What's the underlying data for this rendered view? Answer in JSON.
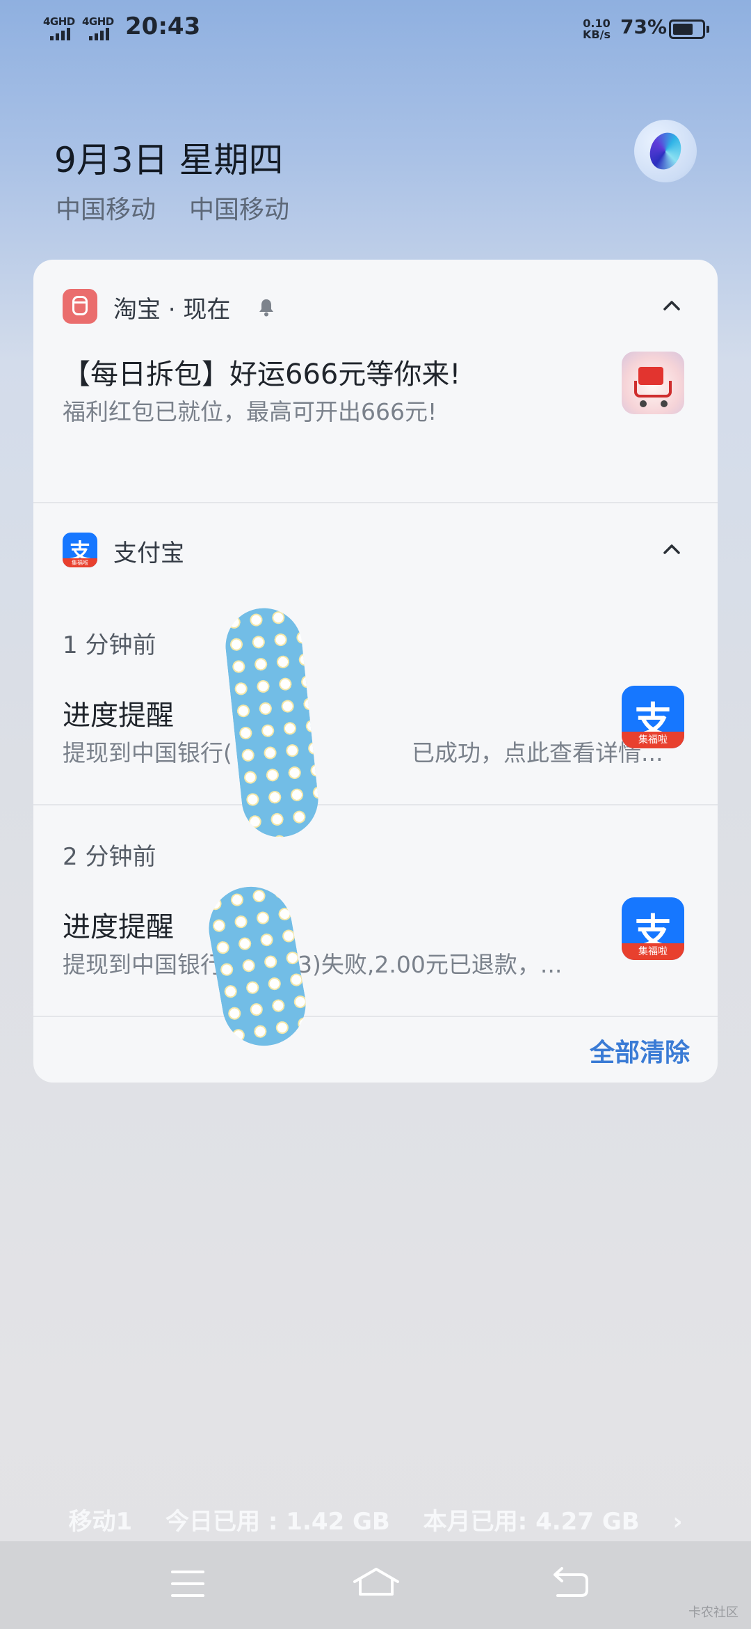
{
  "status_bar": {
    "signal1_label": "4GHD",
    "signal2_label": "4GHD",
    "time": "20:43",
    "net_speed_value": "0.10",
    "net_speed_unit": "KB/s",
    "battery_percent": "73%",
    "battery_level": 0.73
  },
  "header": {
    "date": "9月3日 星期四",
    "carrier1": "中国移动",
    "carrier2": "中国移动",
    "assistant_icon": "jovi-orb-icon"
  },
  "notifications": {
    "taobao": {
      "app_name": "淘宝 · 现在",
      "title": "【每日拆包】好运666元等你来!",
      "body": "福利红包已就位，最高可开出666元!",
      "thumbnail": "shopping-cart-icon"
    },
    "alipay": {
      "app_name": "支付宝",
      "icon_char": "支",
      "icon_band": "集福啦",
      "items": [
        {
          "time": "1 分钟前",
          "title": "进度提醒",
          "body_start": "提现到中国银行(",
          "body_end": "已成功，点此查看详情..."
        },
        {
          "time": "2 分钟前",
          "title": "进度提醒",
          "body_start": "提现到中国银行",
          "body_end": "3)失败,2.00元已退款，..."
        }
      ]
    },
    "clear_all": "全部清除"
  },
  "data_usage": {
    "sim": "移动1",
    "today": "今日已用 : 1.42 GB",
    "month": "本月已用: 4.27 GB",
    "arrow": "›"
  },
  "nav": {
    "menu_icon": "menu-icon",
    "home_icon": "home-icon",
    "back_icon": "back-icon"
  },
  "watermark": "卡农社区"
}
